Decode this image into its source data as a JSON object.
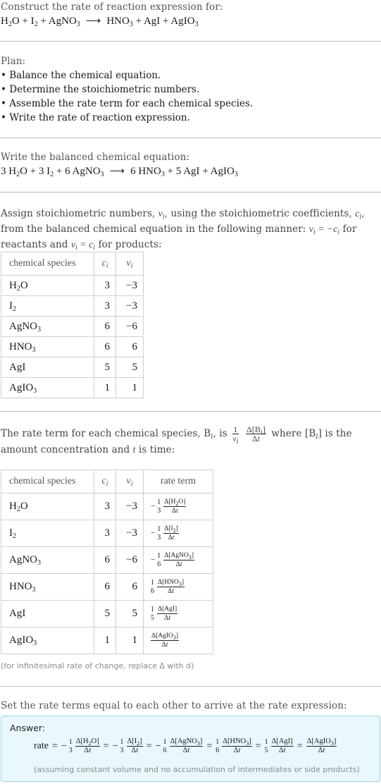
{
  "header": {
    "title": "Construct the rate of reaction expression for:",
    "reaction": {
      "reactants": [
        [
          "H",
          "2",
          "O"
        ],
        [
          "I",
          "2",
          ""
        ],
        [
          "AgNO",
          "3",
          ""
        ]
      ],
      "products": [
        [
          "HNO",
          "3",
          ""
        ],
        [
          "AgI",
          "",
          ""
        ],
        [
          "AgIO",
          "3",
          ""
        ]
      ]
    }
  },
  "plan": {
    "title": "Plan:",
    "items": [
      "• Balance the chemical equation.",
      "• Determine the stoichiometric numbers.",
      "• Assemble the rate term for each chemical species.",
      "• Write the rate of reaction expression."
    ]
  },
  "balanced": {
    "title": "Write the balanced chemical equation:",
    "coefficients": [
      "3",
      "3",
      "6",
      "6",
      "5",
      ""
    ]
  },
  "stoich": {
    "intro_1": "Assign stoichiometric numbers, ",
    "intro_2": ", using the stoichiometric coefficients, ",
    "intro_3": ", from the balanced chemical equation in the following manner: ",
    "intro_4": " for reactants and ",
    "intro_5": " for products:",
    "columns": [
      "chemical species",
      "c",
      "ν"
    ],
    "rows": [
      {
        "species": "H",
        "sub": "2",
        "tail": "O",
        "c": "3",
        "v": "−3"
      },
      {
        "species": "I",
        "sub": "2",
        "tail": "",
        "c": "3",
        "v": "−3"
      },
      {
        "species": "AgNO",
        "sub": "3",
        "tail": "",
        "c": "6",
        "v": "−6"
      },
      {
        "species": "HNO",
        "sub": "3",
        "tail": "",
        "c": "6",
        "v": "6"
      },
      {
        "species": "AgI",
        "sub": "",
        "tail": "",
        "c": "5",
        "v": "5"
      },
      {
        "species": "AgIO",
        "sub": "3",
        "tail": "",
        "c": "1",
        "v": "1"
      }
    ]
  },
  "rate_terms": {
    "intro_1": "The rate term for each chemical species, B",
    "intro_2": ", is",
    "intro_3": "where [B",
    "intro_4": "] is the amount concentration and ",
    "intro_5": " is time:",
    "columns": [
      "chemical species",
      "c",
      "ν",
      "rate term"
    ],
    "rows": [
      {
        "sign": "−",
        "coef": "3",
        "species": "H",
        "sub": "2",
        "tail": "O"
      },
      {
        "sign": "−",
        "coef": "3",
        "species": "I",
        "sub": "2",
        "tail": ""
      },
      {
        "sign": "−",
        "coef": "6",
        "species": "AgNO",
        "sub": "3",
        "tail": ""
      },
      {
        "sign": "",
        "coef": "6",
        "species": "HNO",
        "sub": "3",
        "tail": ""
      },
      {
        "sign": "",
        "coef": "5",
        "species": "AgI",
        "sub": "",
        "tail": ""
      },
      {
        "sign": "",
        "coef": "",
        "species": "AgIO",
        "sub": "3",
        "tail": ""
      }
    ],
    "note": "(for infinitesimal rate of change, replace Δ with d)"
  },
  "answer": {
    "intro": "Set the rate terms equal to each other to arrive at the rate expression:",
    "label": "Answer:",
    "rate_word": "rate",
    "note": "(assuming constant volume and no accumulation of intermediates or side products)"
  },
  "colors": {
    "answer_bg": "#e8f8fd",
    "answer_border": "#9fd0e0",
    "divider": "#bdbdbd"
  }
}
